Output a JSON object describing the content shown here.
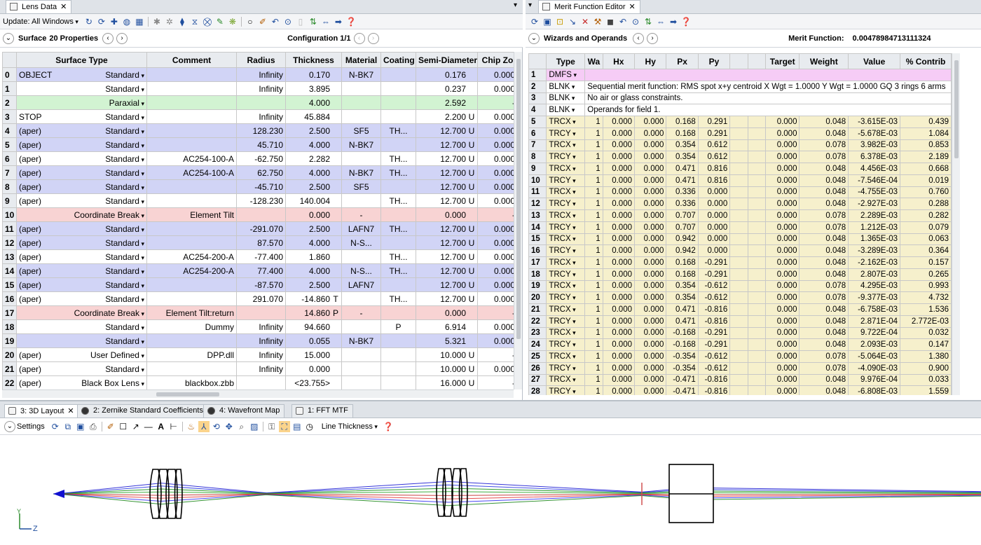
{
  "lens": {
    "tab": "Lens Data",
    "update_label": "Update: All Windows",
    "surface_label": "Surface",
    "properties_label": "20 Properties",
    "config_label": "Configuration 1/1",
    "columns": [
      "",
      "Surface Type",
      "Comment",
      "Radius",
      "Thickness",
      "Material",
      "Coating",
      "Semi-Diameter",
      "Chip Zo"
    ],
    "rows": [
      {
        "n": "0",
        "name": "OBJECT",
        "type": "Standard",
        "comment": "",
        "radius": "Infinity",
        "thick": "0.170",
        "tflag": "",
        "mat": "N-BK7",
        "coat": "",
        "semi": "0.176",
        "sflag": "",
        "chip": "0.000",
        "color": "blue"
      },
      {
        "n": "1",
        "name": "",
        "type": "Standard",
        "comment": "",
        "radius": "Infinity",
        "thick": "3.895",
        "tflag": "",
        "mat": "",
        "coat": "",
        "semi": "0.237",
        "sflag": "",
        "chip": "0.000",
        "color": "white"
      },
      {
        "n": "2",
        "name": "",
        "type": "Paraxial",
        "comment": "",
        "radius": "",
        "thick": "4.000",
        "tflag": "",
        "mat": "",
        "coat": "",
        "semi": "2.592",
        "sflag": "",
        "chip": "-",
        "color": "green"
      },
      {
        "n": "3",
        "name": "STOP",
        "type": "Standard",
        "comment": "",
        "radius": "Infinity",
        "thick": "45.884",
        "tflag": "",
        "mat": "",
        "coat": "",
        "semi": "2.200",
        "sflag": "U",
        "chip": "0.000",
        "color": "white"
      },
      {
        "n": "4",
        "name": "(aper)",
        "type": "Standard",
        "comment": "",
        "radius": "128.230",
        "thick": "2.500",
        "tflag": "",
        "mat": "SF5",
        "coat": "TH...",
        "semi": "12.700",
        "sflag": "U",
        "chip": "0.000",
        "color": "blue"
      },
      {
        "n": "5",
        "name": "(aper)",
        "type": "Standard",
        "comment": "",
        "radius": "45.710",
        "thick": "4.000",
        "tflag": "",
        "mat": "N-BK7",
        "coat": "",
        "semi": "12.700",
        "sflag": "U",
        "chip": "0.000",
        "color": "blue"
      },
      {
        "n": "6",
        "name": "(aper)",
        "type": "Standard",
        "comment": "AC254-100-A",
        "radius": "-62.750",
        "thick": "2.282",
        "tflag": "",
        "mat": "",
        "coat": "TH...",
        "semi": "12.700",
        "sflag": "U",
        "chip": "0.000",
        "color": "white"
      },
      {
        "n": "7",
        "name": "(aper)",
        "type": "Standard",
        "comment": "AC254-100-A",
        "radius": "62.750",
        "thick": "4.000",
        "tflag": "",
        "mat": "N-BK7",
        "coat": "TH...",
        "semi": "12.700",
        "sflag": "U",
        "chip": "0.000",
        "color": "blue"
      },
      {
        "n": "8",
        "name": "(aper)",
        "type": "Standard",
        "comment": "",
        "radius": "-45.710",
        "thick": "2.500",
        "tflag": "",
        "mat": "SF5",
        "coat": "",
        "semi": "12.700",
        "sflag": "U",
        "chip": "0.000",
        "color": "blue"
      },
      {
        "n": "9",
        "name": "(aper)",
        "type": "Standard",
        "comment": "",
        "radius": "-128.230",
        "thick": "140.004",
        "tflag": "",
        "mat": "",
        "coat": "TH...",
        "semi": "12.700",
        "sflag": "U",
        "chip": "0.000",
        "color": "white"
      },
      {
        "n": "10",
        "name": "",
        "type": "Coordinate Break",
        "comment": "Element Tilt",
        "radius": "",
        "thick": "0.000",
        "tflag": "",
        "mat": "-",
        "coat": "",
        "semi": "0.000",
        "sflag": "",
        "chip": "-",
        "color": "red"
      },
      {
        "n": "11",
        "name": "(aper)",
        "type": "Standard",
        "comment": "",
        "radius": "-291.070",
        "thick": "2.500",
        "tflag": "",
        "mat": "LAFN7",
        "coat": "TH...",
        "semi": "12.700",
        "sflag": "U",
        "chip": "0.000",
        "color": "blue"
      },
      {
        "n": "12",
        "name": "(aper)",
        "type": "Standard",
        "comment": "",
        "radius": "87.570",
        "thick": "4.000",
        "tflag": "",
        "mat": "N-S...",
        "coat": "",
        "semi": "12.700",
        "sflag": "U",
        "chip": "0.000",
        "color": "blue"
      },
      {
        "n": "13",
        "name": "(aper)",
        "type": "Standard",
        "comment": "AC254-200-A",
        "radius": "-77.400",
        "thick": "1.860",
        "tflag": "",
        "mat": "",
        "coat": "TH...",
        "semi": "12.700",
        "sflag": "U",
        "chip": "0.000",
        "color": "white"
      },
      {
        "n": "14",
        "name": "(aper)",
        "type": "Standard",
        "comment": "AC254-200-A",
        "radius": "77.400",
        "thick": "4.000",
        "tflag": "",
        "mat": "N-S...",
        "coat": "TH...",
        "semi": "12.700",
        "sflag": "U",
        "chip": "0.000",
        "color": "blue"
      },
      {
        "n": "15",
        "name": "(aper)",
        "type": "Standard",
        "comment": "",
        "radius": "-87.570",
        "thick": "2.500",
        "tflag": "",
        "mat": "LAFN7",
        "coat": "",
        "semi": "12.700",
        "sflag": "U",
        "chip": "0.000",
        "color": "blue"
      },
      {
        "n": "16",
        "name": "(aper)",
        "type": "Standard",
        "comment": "",
        "radius": "291.070",
        "thick": "-14.860",
        "tflag": "T",
        "mat": "",
        "coat": "TH...",
        "semi": "12.700",
        "sflag": "U",
        "chip": "0.000",
        "color": "white"
      },
      {
        "n": "17",
        "name": "",
        "type": "Coordinate Break",
        "comment": "Element Tilt:return",
        "radius": "",
        "thick": "14.860",
        "tflag": "P",
        "mat": "-",
        "coat": "",
        "semi": "0.000",
        "sflag": "",
        "chip": "-",
        "color": "red"
      },
      {
        "n": "18",
        "name": "",
        "type": "Standard",
        "comment": "Dummy",
        "radius": "Infinity",
        "thick": "94.660",
        "tflag": "",
        "mat": "",
        "coat": "P",
        "semi": "6.914",
        "sflag": "",
        "chip": "0.000",
        "color": "white"
      },
      {
        "n": "19",
        "name": "",
        "type": "Standard",
        "comment": "",
        "radius": "Infinity",
        "thick": "0.055",
        "tflag": "",
        "mat": "N-BK7",
        "coat": "",
        "semi": "5.321",
        "sflag": "",
        "chip": "0.000",
        "color": "blue"
      },
      {
        "n": "20",
        "name": "(aper)",
        "type": "User Defined",
        "comment": "DPP.dll",
        "radius": "Infinity",
        "thick": "15.000",
        "tflag": "",
        "mat": "",
        "coat": "",
        "semi": "10.000",
        "sflag": "U",
        "chip": "-",
        "color": "white"
      },
      {
        "n": "21",
        "name": "(aper)",
        "type": "Standard",
        "comment": "",
        "radius": "Infinity",
        "thick": "0.000",
        "tflag": "",
        "mat": "",
        "coat": "",
        "semi": "10.000",
        "sflag": "U",
        "chip": "0.000",
        "color": "white"
      },
      {
        "n": "22",
        "name": "(aper)",
        "type": "Black Box Lens",
        "comment": "blackbox.zbb",
        "radius": "",
        "thick": "<23.755>",
        "tflag": "",
        "mat": "",
        "coat": "",
        "semi": "16.000",
        "sflag": "U",
        "chip": "-",
        "color": "white"
      }
    ]
  },
  "mf": {
    "tab": "Merit Function Editor",
    "wizards_label": "Wizards and Operands",
    "merit_label": "Merit Function:",
    "merit_value": "0.00478984713111324",
    "columns": [
      "",
      "Type",
      "Wa",
      "Hx",
      "Hy",
      "Px",
      "Py",
      "",
      "",
      "Target",
      "Weight",
      "Value",
      "% Contrib"
    ],
    "blnk": [
      {
        "n": "1",
        "type": "DMFS",
        "text": ""
      },
      {
        "n": "2",
        "type": "BLNK",
        "text": "Sequential merit function: RMS spot x+y centroid X Wgt = 1.0000 Y Wgt = 1.0000 GQ 3 rings 6 arms"
      },
      {
        "n": "3",
        "type": "BLNK",
        "text": "No air or glass constraints."
      },
      {
        "n": "4",
        "type": "BLNK",
        "text": "Operands for field 1."
      }
    ],
    "rows": [
      {
        "n": "5",
        "type": "TRCX",
        "wa": "1",
        "hx": "0.000",
        "hy": "0.000",
        "px": "0.168",
        "py": "0.291",
        "target": "0.000",
        "weight": "0.048",
        "value": "-3.615E-03",
        "contrib": "0.439"
      },
      {
        "n": "6",
        "type": "TRCY",
        "wa": "1",
        "hx": "0.000",
        "hy": "0.000",
        "px": "0.168",
        "py": "0.291",
        "target": "0.000",
        "weight": "0.048",
        "value": "-5.678E-03",
        "contrib": "1.084"
      },
      {
        "n": "7",
        "type": "TRCX",
        "wa": "1",
        "hx": "0.000",
        "hy": "0.000",
        "px": "0.354",
        "py": "0.612",
        "target": "0.000",
        "weight": "0.078",
        "value": "3.982E-03",
        "contrib": "0.853"
      },
      {
        "n": "8",
        "type": "TRCY",
        "wa": "1",
        "hx": "0.000",
        "hy": "0.000",
        "px": "0.354",
        "py": "0.612",
        "target": "0.000",
        "weight": "0.078",
        "value": "6.378E-03",
        "contrib": "2.189"
      },
      {
        "n": "9",
        "type": "TRCX",
        "wa": "1",
        "hx": "0.000",
        "hy": "0.000",
        "px": "0.471",
        "py": "0.816",
        "target": "0.000",
        "weight": "0.048",
        "value": "4.456E-03",
        "contrib": "0.668"
      },
      {
        "n": "10",
        "type": "TRCY",
        "wa": "1",
        "hx": "0.000",
        "hy": "0.000",
        "px": "0.471",
        "py": "0.816",
        "target": "0.000",
        "weight": "0.048",
        "value": "-7.546E-04",
        "contrib": "0.019"
      },
      {
        "n": "11",
        "type": "TRCX",
        "wa": "1",
        "hx": "0.000",
        "hy": "0.000",
        "px": "0.336",
        "py": "0.000",
        "target": "0.000",
        "weight": "0.048",
        "value": "-4.755E-03",
        "contrib": "0.760"
      },
      {
        "n": "12",
        "type": "TRCY",
        "wa": "1",
        "hx": "0.000",
        "hy": "0.000",
        "px": "0.336",
        "py": "0.000",
        "target": "0.000",
        "weight": "0.048",
        "value": "-2.927E-03",
        "contrib": "0.288"
      },
      {
        "n": "13",
        "type": "TRCX",
        "wa": "1",
        "hx": "0.000",
        "hy": "0.000",
        "px": "0.707",
        "py": "0.000",
        "target": "0.000",
        "weight": "0.078",
        "value": "2.289E-03",
        "contrib": "0.282"
      },
      {
        "n": "14",
        "type": "TRCY",
        "wa": "1",
        "hx": "0.000",
        "hy": "0.000",
        "px": "0.707",
        "py": "0.000",
        "target": "0.000",
        "weight": "0.078",
        "value": "1.212E-03",
        "contrib": "0.079"
      },
      {
        "n": "15",
        "type": "TRCX",
        "wa": "1",
        "hx": "0.000",
        "hy": "0.000",
        "px": "0.942",
        "py": "0.000",
        "target": "0.000",
        "weight": "0.048",
        "value": "1.365E-03",
        "contrib": "0.063"
      },
      {
        "n": "16",
        "type": "TRCY",
        "wa": "1",
        "hx": "0.000",
        "hy": "0.000",
        "px": "0.942",
        "py": "0.000",
        "target": "0.000",
        "weight": "0.048",
        "value": "-3.289E-03",
        "contrib": "0.364"
      },
      {
        "n": "17",
        "type": "TRCX",
        "wa": "1",
        "hx": "0.000",
        "hy": "0.000",
        "px": "0.168",
        "py": "-0.291",
        "target": "0.000",
        "weight": "0.048",
        "value": "-2.162E-03",
        "contrib": "0.157"
      },
      {
        "n": "18",
        "type": "TRCY",
        "wa": "1",
        "hx": "0.000",
        "hy": "0.000",
        "px": "0.168",
        "py": "-0.291",
        "target": "0.000",
        "weight": "0.048",
        "value": "2.807E-03",
        "contrib": "0.265"
      },
      {
        "n": "19",
        "type": "TRCX",
        "wa": "1",
        "hx": "0.000",
        "hy": "0.000",
        "px": "0.354",
        "py": "-0.612",
        "target": "0.000",
        "weight": "0.078",
        "value": "4.295E-03",
        "contrib": "0.993"
      },
      {
        "n": "20",
        "type": "TRCY",
        "wa": "1",
        "hx": "0.000",
        "hy": "0.000",
        "px": "0.354",
        "py": "-0.612",
        "target": "0.000",
        "weight": "0.078",
        "value": "-9.377E-03",
        "contrib": "4.732"
      },
      {
        "n": "21",
        "type": "TRCX",
        "wa": "1",
        "hx": "0.000",
        "hy": "0.000",
        "px": "0.471",
        "py": "-0.816",
        "target": "0.000",
        "weight": "0.048",
        "value": "-6.758E-03",
        "contrib": "1.536"
      },
      {
        "n": "22",
        "type": "TRCY",
        "wa": "1",
        "hx": "0.000",
        "hy": "0.000",
        "px": "0.471",
        "py": "-0.816",
        "target": "0.000",
        "weight": "0.048",
        "value": "2.871E-04",
        "contrib": "2.772E-03"
      },
      {
        "n": "23",
        "type": "TRCX",
        "wa": "1",
        "hx": "0.000",
        "hy": "0.000",
        "px": "-0.168",
        "py": "-0.291",
        "target": "0.000",
        "weight": "0.048",
        "value": "9.722E-04",
        "contrib": "0.032"
      },
      {
        "n": "24",
        "type": "TRCY",
        "wa": "1",
        "hx": "0.000",
        "hy": "0.000",
        "px": "-0.168",
        "py": "-0.291",
        "target": "0.000",
        "weight": "0.048",
        "value": "2.093E-03",
        "contrib": "0.147"
      },
      {
        "n": "25",
        "type": "TRCX",
        "wa": "1",
        "hx": "0.000",
        "hy": "0.000",
        "px": "-0.354",
        "py": "-0.612",
        "target": "0.000",
        "weight": "0.078",
        "value": "-5.064E-03",
        "contrib": "1.380"
      },
      {
        "n": "26",
        "type": "TRCY",
        "wa": "1",
        "hx": "0.000",
        "hy": "0.000",
        "px": "-0.354",
        "py": "-0.612",
        "target": "0.000",
        "weight": "0.078",
        "value": "-4.090E-03",
        "contrib": "0.900"
      },
      {
        "n": "27",
        "type": "TRCX",
        "wa": "1",
        "hx": "0.000",
        "hy": "0.000",
        "px": "-0.471",
        "py": "-0.816",
        "target": "0.000",
        "weight": "0.048",
        "value": "9.976E-04",
        "contrib": "0.033"
      },
      {
        "n": "28",
        "type": "TRCY",
        "wa": "1",
        "hx": "0.000",
        "hy": "0.000",
        "px": "-0.471",
        "py": "-0.816",
        "target": "0.000",
        "weight": "0.048",
        "value": "-6.808E-03",
        "contrib": "1.559"
      }
    ]
  },
  "bottom": {
    "tabs": [
      {
        "label": "3: 3D Layout",
        "icon": "layout-icon"
      },
      {
        "label": "2: Zernike Standard Coefficients",
        "icon": "zernike-icon"
      },
      {
        "label": "4: Wavefront Map",
        "icon": "wavefront-icon"
      },
      {
        "label": "1: FFT MTF",
        "icon": "mtf-icon"
      }
    ],
    "settings_label": "Settings",
    "line_thickness_label": "Line Thickness",
    "axis_y": "Y",
    "axis_z": "Z"
  },
  "colors": {
    "accent": "#1f4e9e",
    "lens_blue": "#d1d4f6",
    "lens_green": "#d2f3d2",
    "lens_red": "#f8d3d3",
    "mf_pink": "#f6ccf6",
    "mf_yellow": "#f6f0cc"
  }
}
